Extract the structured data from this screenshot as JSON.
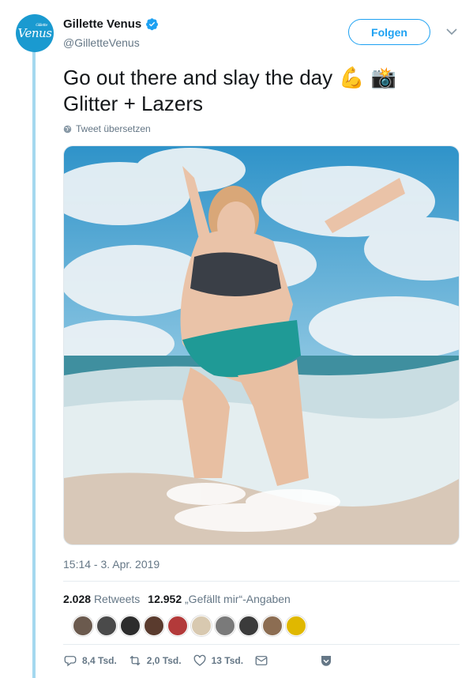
{
  "account": {
    "avatar_text": "Venus",
    "avatar_subtext": "Gillette",
    "name": "Gillette Venus",
    "handle": "@GilletteVenus",
    "verified": true
  },
  "follow_button": {
    "label": "Folgen"
  },
  "tweet": {
    "line1": "Go out there and slay the day",
    "line1_emoji": "💪",
    "line1_emoji2": "📸",
    "line2": "Glitter + Lazers",
    "translate_label": "Tweet übersetzen",
    "timestamp": "15:14 - 3. Apr. 2019"
  },
  "stats": {
    "retweets_count": "2.028",
    "retweets_label": "Retweets",
    "likes_count": "12.952",
    "likes_label": "„Gefällt mir“-Angaben"
  },
  "likers": {
    "count": 10
  },
  "actions": {
    "replies": "8,4 Tsd.",
    "retweets": "2,0 Tsd.",
    "likes": "13 Tsd."
  },
  "colors": {
    "accent": "#1da1f2",
    "thread_line": "#a4d8ef",
    "muted": "#657786"
  }
}
